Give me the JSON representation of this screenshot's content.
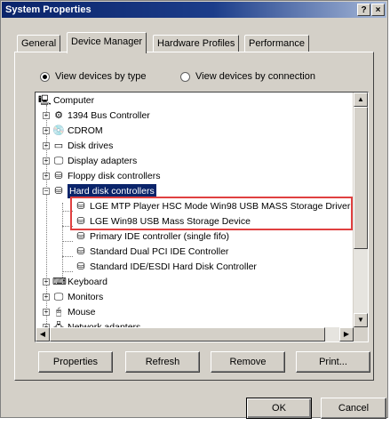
{
  "window": {
    "title": "System Properties",
    "help_label": "?",
    "close_label": "×"
  },
  "tabs": [
    {
      "label": "General",
      "active": false
    },
    {
      "label": "Device Manager",
      "active": true
    },
    {
      "label": "Hardware Profiles",
      "active": false
    },
    {
      "label": "Performance",
      "active": false
    }
  ],
  "view": {
    "by_type_label": "View devices by type",
    "by_connection_label": "View devices by connection",
    "selected": "by_type"
  },
  "tree": {
    "root": "Computer",
    "items": [
      {
        "label": "1394 Bus Controller",
        "icon": "bus-icon",
        "expander": "+"
      },
      {
        "label": "CDROM",
        "icon": "cdrom-icon",
        "expander": "+"
      },
      {
        "label": "Disk drives",
        "icon": "disk-drive-icon",
        "expander": "+"
      },
      {
        "label": "Display adapters",
        "icon": "display-adapter-icon",
        "expander": "+"
      },
      {
        "label": "Floppy disk controllers",
        "icon": "floppy-controller-icon",
        "expander": "+"
      },
      {
        "label": "Hard disk controllers",
        "icon": "hard-disk-controller-icon",
        "expander": "−",
        "selected": true
      }
    ],
    "children": [
      {
        "label": "LGE MTP Player HSC Mode Win98 USB MASS Storage Driver",
        "icon": "controller-icon"
      },
      {
        "label": "LGE Win98 USB Mass Storage Device",
        "icon": "controller-icon"
      },
      {
        "label": "Primary IDE controller (single fifo)",
        "icon": "controller-icon"
      },
      {
        "label": "Standard Dual PCI IDE Controller",
        "icon": "controller-icon"
      },
      {
        "label": "Standard IDE/ESDI Hard Disk Controller",
        "icon": "controller-icon"
      }
    ],
    "after": [
      {
        "label": "Keyboard",
        "icon": "keyboard-icon",
        "expander": "+"
      },
      {
        "label": "Monitors",
        "icon": "monitor-icon",
        "expander": "+"
      },
      {
        "label": "Mouse",
        "icon": "mouse-icon",
        "expander": "+"
      },
      {
        "label": "Network adapters",
        "icon": "network-icon",
        "expander": "+"
      }
    ]
  },
  "buttons": {
    "properties": "Properties",
    "refresh": "Refresh",
    "remove": "Remove",
    "print": "Print...",
    "ok": "OK",
    "cancel": "Cancel"
  },
  "colors": {
    "title_bar": "#0a246a",
    "selection": "#0a246a",
    "highlight_box": "#e04040",
    "face": "#d4d0c8"
  }
}
